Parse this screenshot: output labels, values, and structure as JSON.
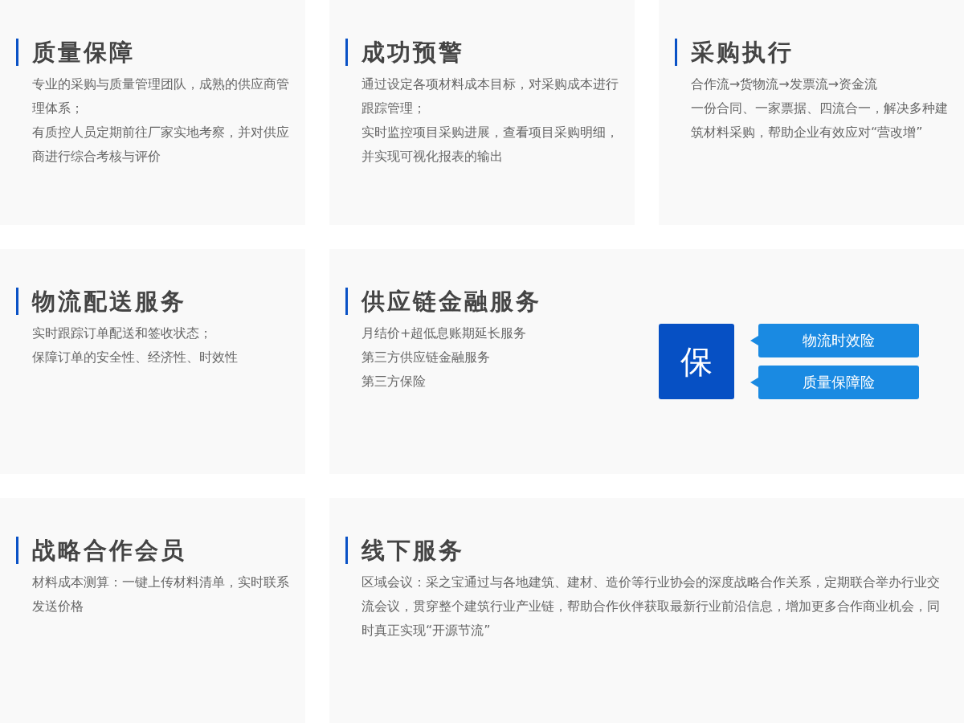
{
  "cards": [
    {
      "title": "质量保障",
      "paragraphs": [
        "专业的采购与质量管理团队，成熟的供应商管理体系；",
        "有质控人员定期前往厂家实地考察，并对供应商进行综合考核与评价"
      ]
    },
    {
      "title": "成功预警",
      "paragraphs": [
        "通过设定各项材料成本目标，对采购成本进行跟踪管理；",
        "实时监控项目采购进展，查看项目采购明细，并实现可视化报表的输出"
      ]
    },
    {
      "title": "采购执行",
      "paragraphs": [
        "合作流→货物流→发票流→资金流",
        "一份合同、一家票据、四流合一，解决多种建筑材料采购，帮助企业有效应对“营改增”"
      ]
    },
    {
      "title": "物流配送服务",
      "paragraphs": [
        "实时跟踪订单配送和签收状态；",
        "保障订单的安全性、经济性、时效性"
      ]
    },
    {
      "title": "供应链金融服务",
      "wide": true,
      "paragraphs": [
        "月结价+超低息账期延长服务",
        "第三方供应链金融服务",
        "第三方保险"
      ],
      "insurance": {
        "badge": "保",
        "tags": [
          "物流时效险",
          "质量保障险"
        ]
      }
    },
    {
      "title": "战略合作会员",
      "paragraphs": [
        "材料成本测算：一键上传材料清单，实时联系发送价格"
      ]
    },
    {
      "title": "线下服务",
      "wide": true,
      "paragraphs": [
        "区域会议：采之宝通过与各地建筑、建材、造价等行业协会的深度战略合作关系，定期联合举办行业交流会议，贯穿整个建筑行业产业链，帮助合作伙伴获取最新行业前沿信息，增加更多合作商业机会，同时真正实现“开源节流”"
      ]
    }
  ]
}
